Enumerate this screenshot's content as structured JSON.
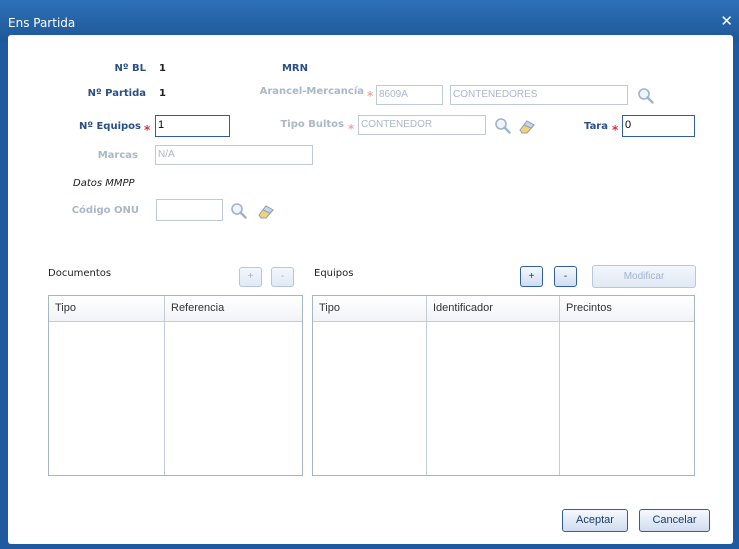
{
  "window": {
    "title": "Ens Partida",
    "close_glyph": "✕"
  },
  "form": {
    "bl": {
      "label": "Nº BL",
      "value": "1"
    },
    "mrn": {
      "label": "MRN",
      "value": ""
    },
    "partida": {
      "label": "Nº Partida",
      "value": "1"
    },
    "arancel": {
      "label": "Arancel-Mercancía",
      "code": "8609A",
      "description": "CONTENEDORES"
    },
    "equipos": {
      "label": "Nº Equipos",
      "value": "1"
    },
    "tipo_bultos": {
      "label": "Tipo Bultos",
      "value": "CONTENEDOR"
    },
    "tara": {
      "label": "Tara",
      "value": "0"
    },
    "marcas": {
      "label": "Marcas",
      "value": "N/A"
    },
    "datos_mmpp": {
      "label": "Datos MMPP"
    },
    "codigo_onu": {
      "label": "Código ONU",
      "value": ""
    },
    "required_mark": "*"
  },
  "documentos": {
    "title": "Documentos",
    "add_label": "+",
    "remove_label": "-",
    "columns": [
      "Tipo",
      "Referencia"
    ],
    "rows": []
  },
  "equipos_panel": {
    "title": "Equipos",
    "add_label": "+",
    "remove_label": "-",
    "modify_label": "Modificar",
    "columns": [
      "Tipo",
      "Identificador",
      "Precintos"
    ],
    "rows": []
  },
  "footer": {
    "accept_label": "Aceptar",
    "cancel_label": "Cancelar"
  },
  "icons": {
    "search": "search-icon",
    "eraser": "eraser-icon"
  },
  "colors": {
    "titlebar": "#1f5aa0",
    "label": "#2a4f86",
    "required": "#e0303a",
    "button_border": "#2f5f9e"
  }
}
